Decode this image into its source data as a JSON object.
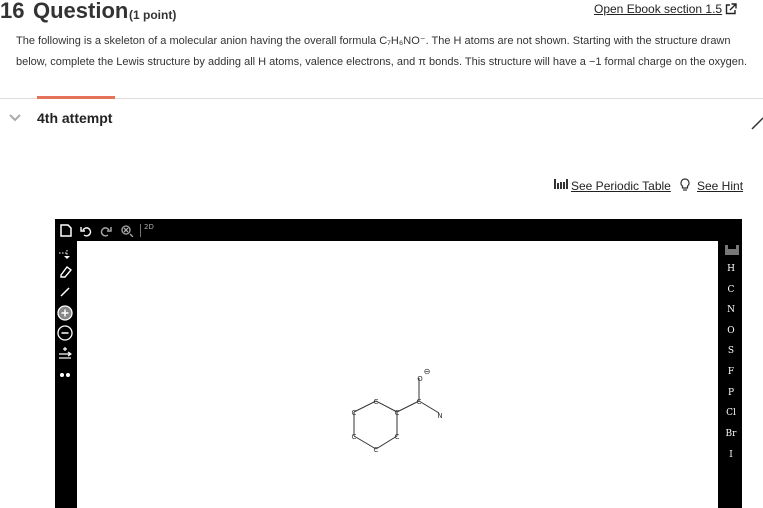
{
  "question": {
    "number": "16",
    "title": "Question",
    "points": "(1 point)",
    "ebook_link": "Open Ebook section 1.5",
    "text_line1": "The following is a skeleton of a molecular anion having the overall formula C₇H₆NO⁻. The H atoms are not shown. Starting with the structure drawn",
    "text_line2": "below, complete the Lewis structure by adding all H atoms, valence electrons, and π bonds. This structure will have a −1 formal charge on the oxygen."
  },
  "attempt": {
    "label": "4th attempt"
  },
  "links": {
    "periodic_table": "See Periodic Table",
    "hint": "See Hint"
  },
  "toolbar": {
    "top_icons": [
      "new-document-icon",
      "undo-icon",
      "redo-icon",
      "clean-icon",
      "2d-3d-icon"
    ],
    "left_icons": [
      "select-icon",
      "eraser-icon",
      "bond-icon",
      "positive-charge-icon",
      "negative-charge-icon",
      "arrow-icon",
      "electron-pair-icon"
    ],
    "label_2d": "2D"
  },
  "elements": [
    "H",
    "C",
    "N",
    "O",
    "S",
    "F",
    "P",
    "Cl",
    "Br",
    "I"
  ],
  "molecule": {
    "atoms": [
      "C",
      "C",
      "C",
      "C",
      "C",
      "C",
      "C",
      "O",
      "N"
    ],
    "charge_symbol": "⊖"
  }
}
